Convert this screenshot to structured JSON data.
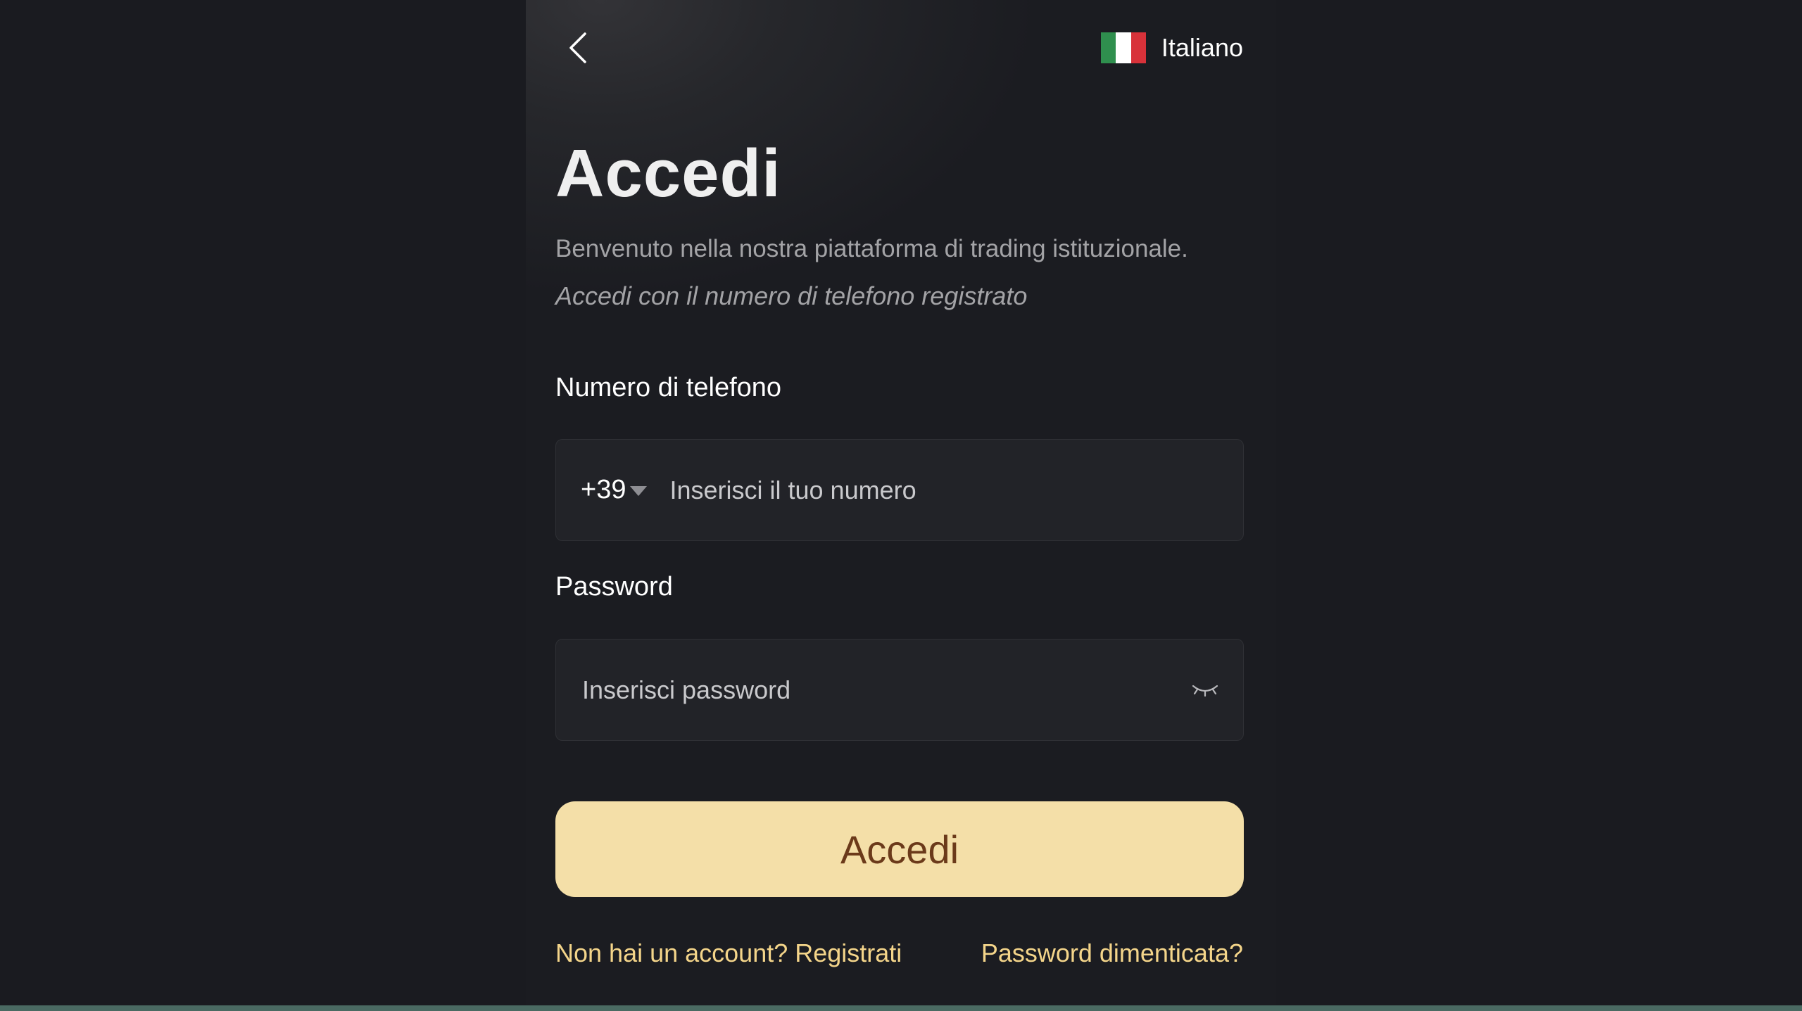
{
  "header": {
    "back_icon": "chevron-left-icon",
    "language": {
      "label": "Italiano",
      "flag_icon": "italy-flag-icon",
      "flag_colors": [
        "#2f8f4e",
        "#ffffff",
        "#d8323a"
      ]
    }
  },
  "main": {
    "title": "Accedi",
    "welcome": "Benvenuto nella nostra piattaforma di trading istituzionale.",
    "instruction": "Accedi con il numero di telefono registrato"
  },
  "phone_field": {
    "label": "Numero di telefono",
    "country_code": "+39",
    "placeholder": "Inserisci il tuo numero",
    "value": ""
  },
  "password_field": {
    "label": "Password",
    "placeholder": "Inserisci password",
    "value": "",
    "toggle_icon": "eye-closed-icon"
  },
  "submit": {
    "label": "Accedi"
  },
  "footer": {
    "register_link": "Non hai un account? Registrati",
    "forgot_link": "Password dimenticata?"
  },
  "colors": {
    "background": "#1a1b20",
    "accent_button": "#f4dfa8",
    "button_text": "#6b3a1a",
    "link": "#f4d58a"
  }
}
